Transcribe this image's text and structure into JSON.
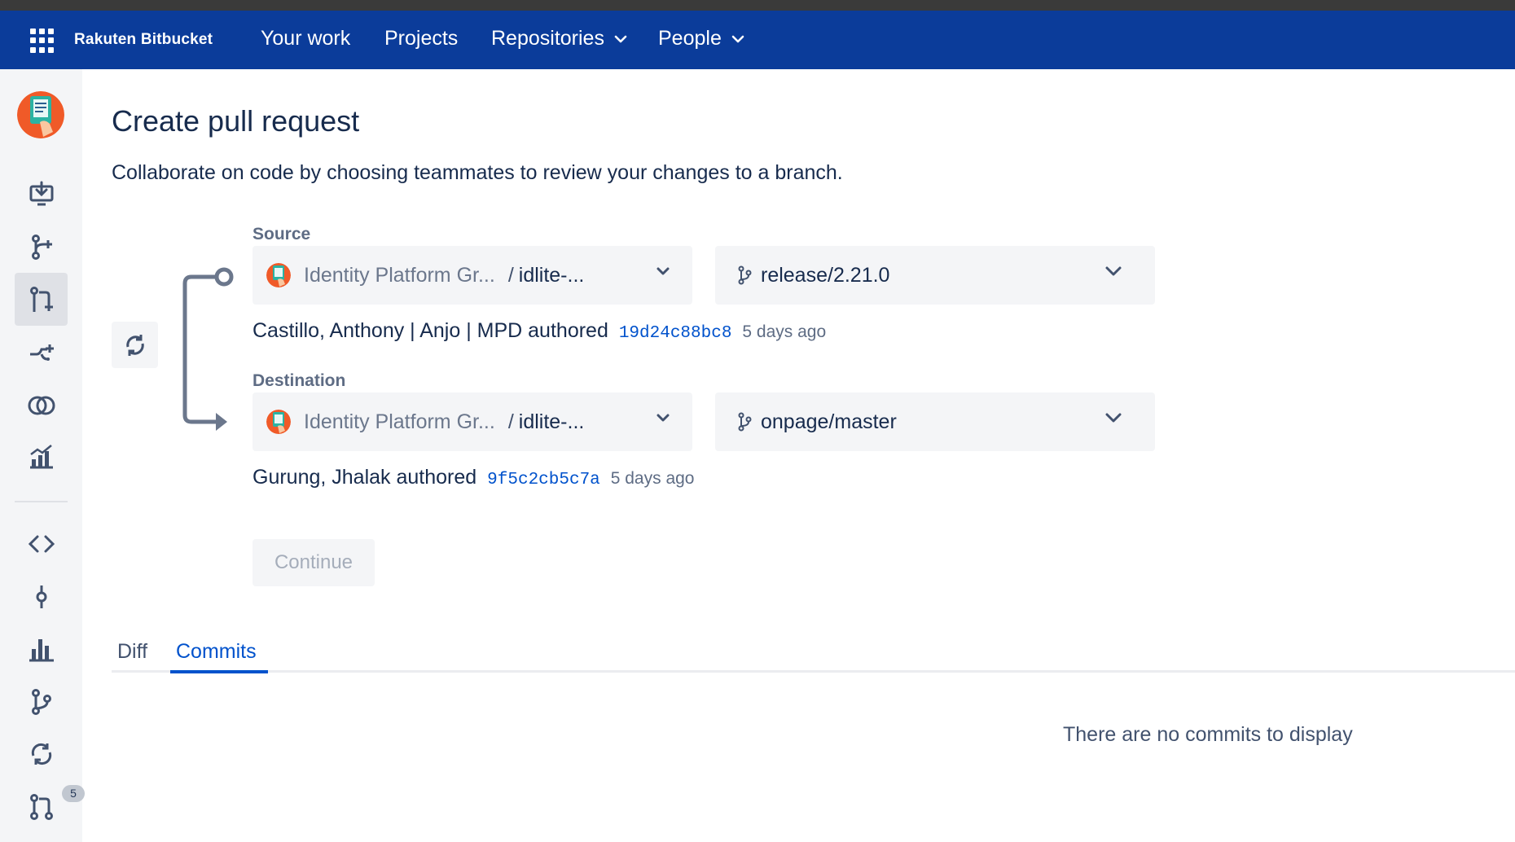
{
  "nav": {
    "brand": "Rakuten Bitbucket",
    "items": [
      {
        "label": "Your work"
      },
      {
        "label": "Projects"
      },
      {
        "label": "Repositories"
      },
      {
        "label": "People"
      }
    ]
  },
  "sidebar": {
    "items": [
      "clone-icon",
      "create-branch-icon",
      "create-pull-request-icon",
      "create-fork-icon",
      "compare-icon",
      "insights-icon",
      "source-icon",
      "commits-icon",
      "reports-icon",
      "branches-icon",
      "sync-icon",
      "pull-requests-icon"
    ],
    "pull_requests_badge": "5"
  },
  "page": {
    "title": "Create pull request",
    "subtitle": "Collaborate on code by choosing teammates to review your changes to a branch."
  },
  "source": {
    "label": "Source",
    "project": "Identity Platform Gr...",
    "slash": "/",
    "repo": "idlite-...",
    "branch": "release/2.21.0",
    "author": "Castillo, Anthony | Anjo | MPD",
    "authored": "authored",
    "hash": "19d24c88bc8",
    "ago": "5 days ago"
  },
  "destination": {
    "label": "Destination",
    "project": "Identity Platform Gr...",
    "slash": "/",
    "repo": "idlite-...",
    "branch": "onpage/master",
    "author": "Gurung, Jhalak",
    "authored": "authored",
    "hash": "9f5c2cb5c7a",
    "ago": "5 days ago"
  },
  "continue_label": "Continue",
  "tabs": [
    {
      "label": "Diff"
    },
    {
      "label": "Commits"
    }
  ],
  "active_tab": "Commits",
  "empty_message": "There are no commits to display",
  "colors": {
    "nav": "#0b3c9a",
    "accent": "#0052cc"
  }
}
